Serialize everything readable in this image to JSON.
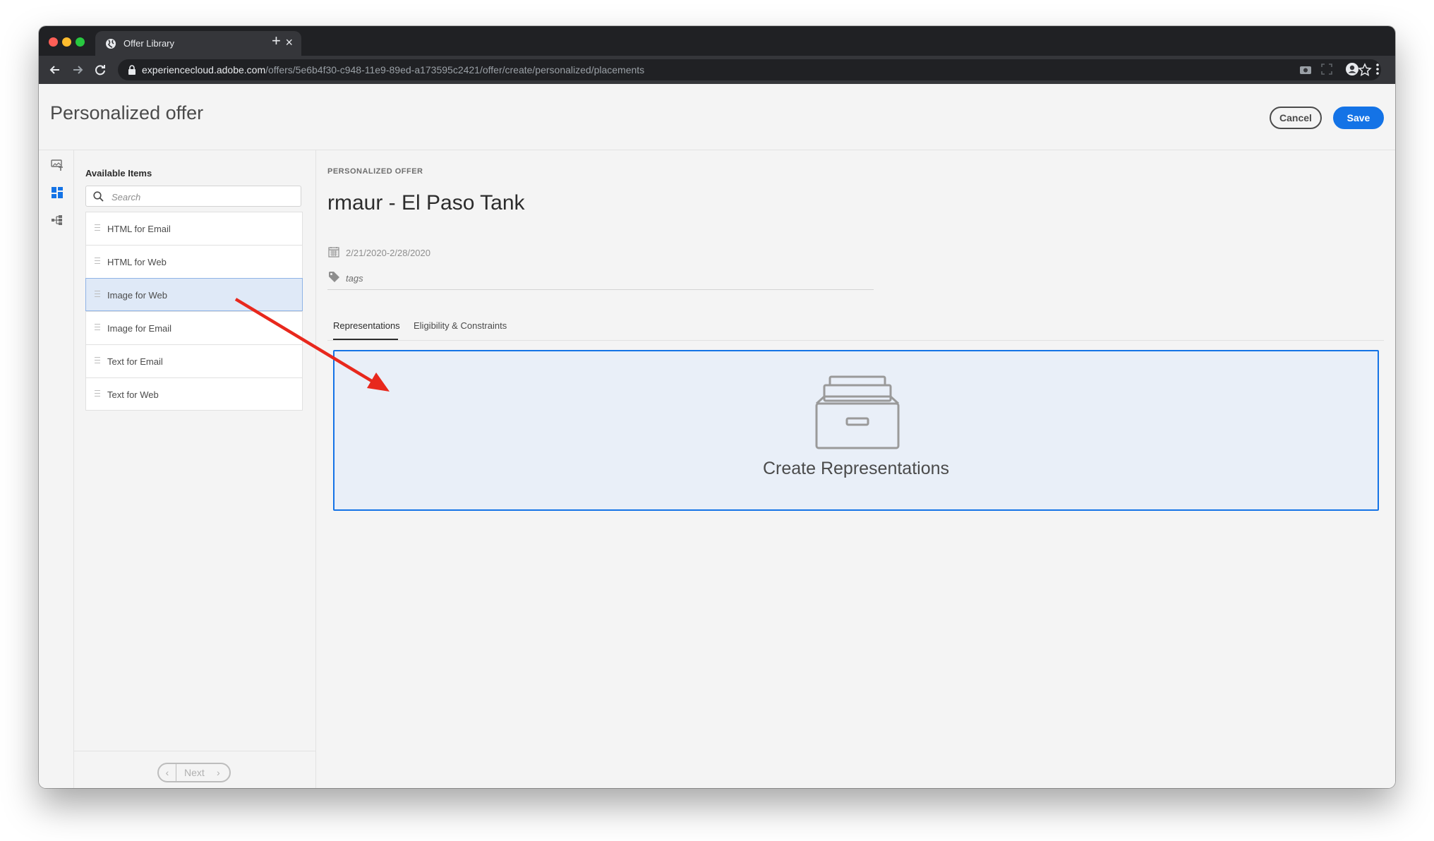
{
  "browser": {
    "tab_title": "Offer Library",
    "tab_close": "×",
    "new_tab": "+",
    "url_host": "experiencecloud.adobe.com",
    "url_path": "/offers/5e6b4f30-c948-11e9-89ed-a173595c2421/offer/create/personalized/placements"
  },
  "header": {
    "title": "Personalized offer",
    "cancel_label": "Cancel",
    "save_label": "Save"
  },
  "panel": {
    "title": "Available Items",
    "search_placeholder": "Search",
    "items": [
      {
        "label": "HTML for Email"
      },
      {
        "label": "HTML for Web"
      },
      {
        "label": "Image for Web"
      },
      {
        "label": "Image for Email"
      },
      {
        "label": "Text for Email"
      },
      {
        "label": "Text for Web"
      }
    ],
    "selected_index": 2,
    "next_label": "Next"
  },
  "offer": {
    "eyebrow": "PERSONALIZED OFFER",
    "name": "rmaur - El Paso Tank",
    "date_range": "2/21/2020-2/28/2020",
    "tags_placeholder": "tags"
  },
  "tabs": {
    "representations": "Representations",
    "eligibility": "Eligibility & Constraints"
  },
  "dropzone": {
    "label": "Create Representations"
  },
  "colors": {
    "accent": "#1473e6",
    "annotation_arrow": "#e8281d"
  }
}
